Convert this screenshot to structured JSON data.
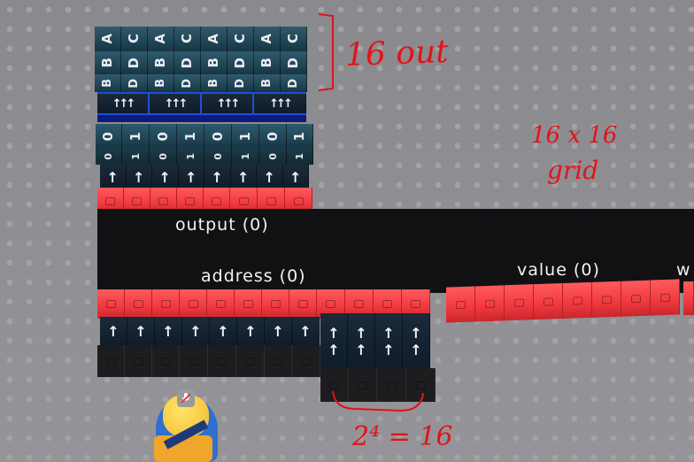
{
  "blocks": {
    "letters_top": [
      "A",
      "C",
      "A",
      "C",
      "A",
      "C",
      "A",
      "C"
    ],
    "letters_mid": [
      "B",
      "D",
      "B",
      "D",
      "B",
      "D",
      "B",
      "D"
    ],
    "letters_low": [
      "B",
      "D",
      "B",
      "D",
      "B",
      "D",
      "B",
      "D"
    ],
    "bits_top": [
      "0",
      "1",
      "0",
      "1",
      "0",
      "1",
      "0",
      "1"
    ],
    "bits_low": [
      "0",
      "1",
      "0",
      "1",
      "0",
      "1",
      "0",
      "1"
    ],
    "arrow_glyph": "↑"
  },
  "panel": {
    "output_label": "output (0)",
    "address_label": "address (0)",
    "value_label": "value (0)",
    "cutoff_label": "w"
  },
  "annotations": {
    "bits_out": "16 out",
    "grid": "16 x 16",
    "grid_word": "grid",
    "formula": "2⁴ = 16"
  },
  "colors": {
    "block_teal": "#224757",
    "block_red": "#f0393f",
    "panel_black": "#111113",
    "annotation_red": "#e0141b",
    "baseplate": "#8d8c90"
  }
}
